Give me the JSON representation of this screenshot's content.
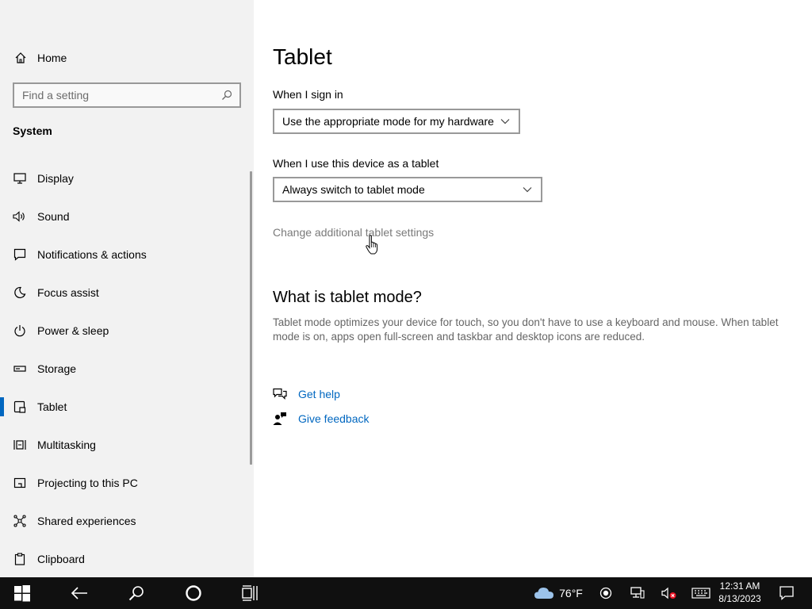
{
  "sidebar": {
    "home_label": "Home",
    "search_placeholder": "Find a setting",
    "section_title": "System",
    "items": [
      {
        "label": "Display",
        "icon": "monitor-icon"
      },
      {
        "label": "Sound",
        "icon": "speaker-icon"
      },
      {
        "label": "Notifications & actions",
        "icon": "notification-icon"
      },
      {
        "label": "Focus assist",
        "icon": "moon-icon"
      },
      {
        "label": "Power & sleep",
        "icon": "power-icon"
      },
      {
        "label": "Storage",
        "icon": "storage-icon"
      },
      {
        "label": "Tablet",
        "icon": "tablet-icon",
        "active": true
      },
      {
        "label": "Multitasking",
        "icon": "multitasking-icon"
      },
      {
        "label": "Projecting to this PC",
        "icon": "projector-icon"
      },
      {
        "label": "Shared experiences",
        "icon": "shared-icon"
      },
      {
        "label": "Clipboard",
        "icon": "clipboard-icon"
      }
    ]
  },
  "main": {
    "title": "Tablet",
    "sign_in_label": "When I sign in",
    "sign_in_value": "Use the appropriate mode for my hardware",
    "tablet_label": "When I use this device as a tablet",
    "tablet_value": "Always switch to tablet mode",
    "additional_link": "Change additional tablet settings",
    "what_title": "What is tablet mode?",
    "what_desc": "Tablet mode optimizes your device for touch, so you don't have to use a keyboard and mouse. When tablet mode is on, apps open full-screen and taskbar and desktop icons are reduced.",
    "get_help": "Get help",
    "give_feedback": "Give feedback"
  },
  "taskbar": {
    "weather": "76°F",
    "time": "12:31 AM",
    "date": "8/13/2023"
  },
  "colors": {
    "accent": "#0067c0",
    "sidebar_bg": "#f2f2f2",
    "taskbar_bg": "#101010"
  }
}
